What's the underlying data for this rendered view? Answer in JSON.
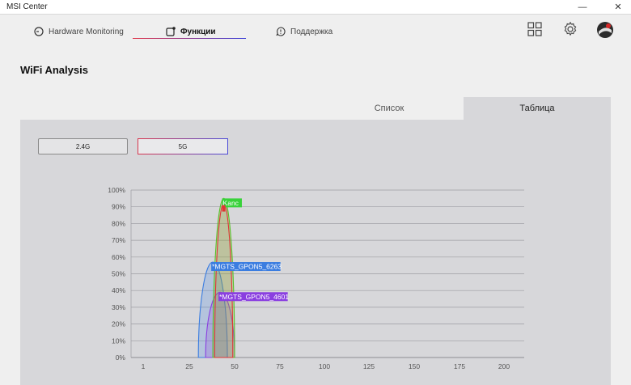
{
  "app": {
    "title": "MSI Center",
    "minimize": "—",
    "close": "✕"
  },
  "nav": {
    "tabs": [
      {
        "label": "Hardware Monitoring",
        "icon": "gauge-icon"
      },
      {
        "label": "Функции",
        "icon": "features-icon"
      },
      {
        "label": "Поддержка",
        "icon": "support-icon"
      }
    ],
    "icons": [
      "grid-icon",
      "gear-icon",
      "avatar"
    ]
  },
  "page": {
    "title": "WiFi Analysis"
  },
  "view_tabs": {
    "list": "Список",
    "table": "Таблица"
  },
  "bands": {
    "b24": "2.4G",
    "b5": "5G"
  },
  "chart_data": {
    "type": "area",
    "y_tick_labels": [
      "0%",
      "10%",
      "20%",
      "30%",
      "40%",
      "50%",
      "60%",
      "70%",
      "80%",
      "90%",
      "100%"
    ],
    "x_tick_labels": [
      "1",
      "25",
      "50",
      "75",
      "100",
      "125",
      "150",
      "175",
      "200"
    ],
    "ylim": [
      0,
      100
    ],
    "grid": true,
    "series": [
      {
        "name": "*MGTS_GPON5_6263",
        "center": 38,
        "width": 16,
        "peak": 57,
        "color": "#3b7de0",
        "fill": "rgba(60,130,230,0.22)",
        "label_bg": "#3b7de0"
      },
      {
        "name": "*MGTS_GPON5_4601",
        "center": 42,
        "width": 16,
        "peak": 39,
        "color": "#8a3fe0",
        "fill": "rgba(140,60,220,0.20)",
        "label_bg": "#8a3fe0"
      },
      {
        "name": "Kanc",
        "center": 44,
        "width": 12,
        "peak": 95,
        "color": "#5ac02a",
        "fill": "rgba(120,200,60,0.30)",
        "label_bg": "#38d23a"
      },
      {
        "name": "",
        "center": 44,
        "width": 10,
        "peak": 92,
        "color": "#e03535",
        "fill": "rgba(220,60,60,0.10)",
        "label_bg": "#e03535"
      }
    ]
  }
}
